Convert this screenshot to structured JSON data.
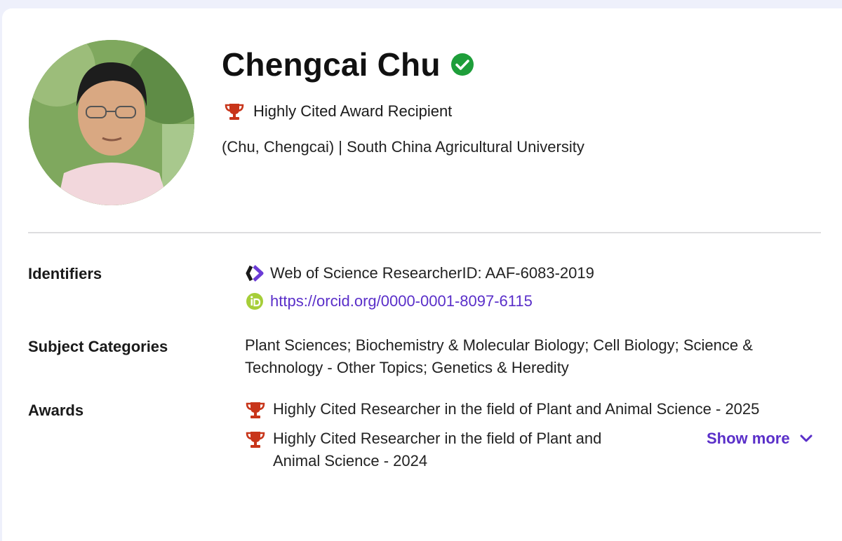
{
  "profile": {
    "name": "Chengcai Chu",
    "badge_text": "Highly Cited Award Recipient",
    "affiliation": "(Chu, Chengcai) | South China Agricultural University"
  },
  "identifiers": {
    "label": "Identifiers",
    "researcher_id": "Web of Science ResearcherID: AAF-6083-2019",
    "orcid_url": "https://orcid.org/0000-0001-8097-6115"
  },
  "subjects": {
    "label": "Subject Categories",
    "line1": "Plant Sciences;  Biochemistry & Molecular Biology;  Cell Biology;  Science &",
    "line2": "Technology - Other Topics;  Genetics & Heredity"
  },
  "awards": {
    "label": "Awards",
    "items": [
      "Highly Cited Researcher in the field of Plant and Animal Science - 2025",
      "Highly Cited Researcher in the field of Plant and Animal Science - 2024"
    ],
    "show_more_label": "Show more"
  },
  "colors": {
    "accent": "#5a2fc9",
    "trophy": "#c8351a",
    "verified": "#1e9e3a",
    "orcid": "#a6ce39"
  }
}
